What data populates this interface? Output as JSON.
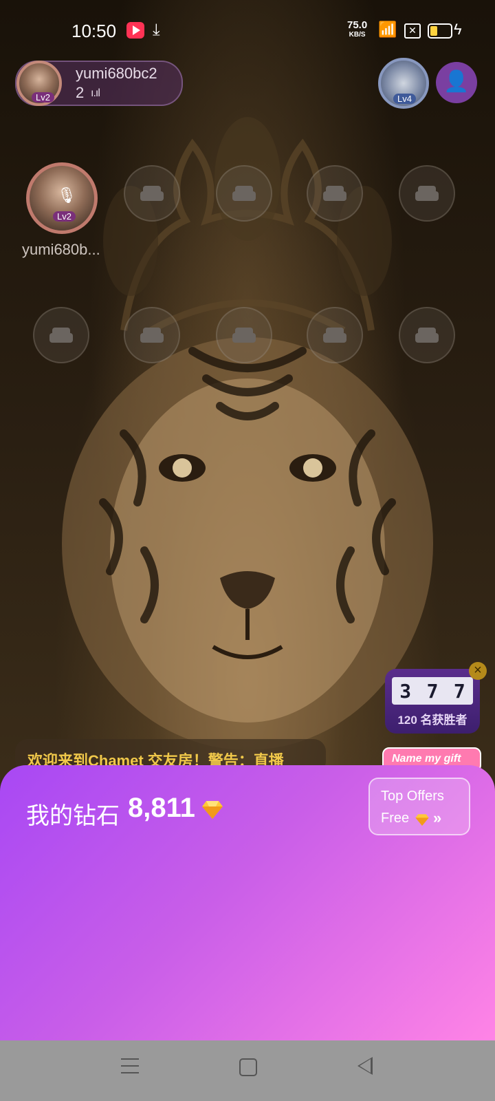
{
  "status_bar": {
    "time": "10:50",
    "speed_value": "75.0",
    "speed_unit": "KB/S"
  },
  "host": {
    "name": "yumi680bc2",
    "audience_count": "2",
    "level": "Lv2"
  },
  "top_right": {
    "badge_level": "Lv4"
  },
  "seats": {
    "occupant_name": "yumi680b...",
    "occupant_level": "Lv2"
  },
  "lucky_draw": {
    "digits": [
      "3",
      "7",
      "7"
    ],
    "winners_text": "120 名获胜者"
  },
  "welcome_message": "欢迎来到Chamet 交友房！警告：直播",
  "name_gift_button": "Name my gift",
  "diamond_panel": {
    "label": "我的钻石",
    "balance": "8,811",
    "offer_title": "Top Offers",
    "offer_subtitle": "Free"
  },
  "colors": {
    "panel_gradient_start": "#a848f4",
    "panel_gradient_end": "#ff84e6",
    "welcome_text": "#f0c84a"
  }
}
